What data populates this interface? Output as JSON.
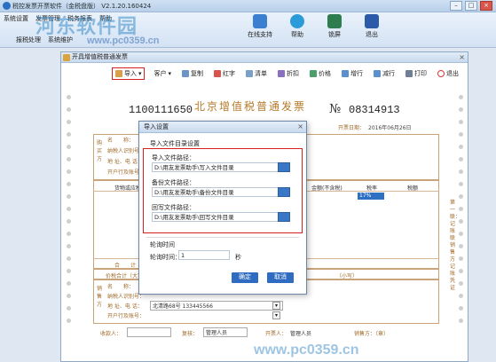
{
  "app": {
    "title": "税控发票开票软件（金税盘版） V2.1.20.160424",
    "menu_row1": [
      "系统设置",
      "发票管理",
      "税务报表",
      "帮助"
    ],
    "menu_row2": [
      "报税处理",
      "系统维护"
    ],
    "tools": [
      {
        "label": "在线支持",
        "icon": "support-icon",
        "color": "#3b7fd1"
      },
      {
        "label": "帮助",
        "icon": "help-icon",
        "color": "#2a9bd8"
      },
      {
        "label": "锁屏",
        "icon": "lock-icon",
        "color": "#2e7d4f"
      },
      {
        "label": "退出",
        "icon": "exit-icon",
        "color": "#2a5aa8"
      }
    ]
  },
  "watermark": {
    "line1": "河东软件园",
    "line2": "www.pc0359.cn",
    "bottom": "www.pc0359.cn"
  },
  "invoice_window": {
    "title": "开具增值税普通发票",
    "toolbar": [
      "导入",
      "客户",
      "复制",
      "红字",
      "清单",
      "折扣",
      "价格",
      "增行",
      "减行",
      "打印",
      "退出"
    ],
    "header": "北京增值税普通发票",
    "code": "1100111650",
    "no_symbol": "№",
    "number": "08314913",
    "issue_date_label": "开票日期：",
    "issue_date": "2016年06月26日",
    "buyer_side": "购买方",
    "buyer_fields": [
      "名　　称：",
      "纳税人识别号：",
      "地 址、电 话：",
      "开户行及账号："
    ],
    "table_headers": [
      "货物或应税劳务、服务名称",
      "金额(不含税)",
      "税率",
      "税额"
    ],
    "tax_rate": "17%",
    "total_label": "合　　计",
    "amount_words_label": "价税合计（大写）",
    "amount_small_label": "（小写）",
    "seller_side": "销售方",
    "seller_address": "北清路68号 13344556​6",
    "seller_fields": [
      "名　　称：",
      "纳税人识别号：",
      "地 址、电 话：",
      "开户行及账号："
    ],
    "right_vertical": "第一联：记账联 销售方记账凭证",
    "payee_label": "收款人：",
    "reviewer_label": "复核：",
    "reviewer": "管理人员",
    "drawer_label": "开票人：",
    "drawer": "管理人员",
    "seller_stamp_label": "销售方：（章）"
  },
  "dialog": {
    "title": "导入设置",
    "section": "导入文件目录设置",
    "import_label": "导入文件路径：",
    "import_path": "D:\\用友发票助手\\写入文件目录",
    "backup_label": "备份文件路径：",
    "backup_path": "D:\\用友发票助手\\备份文件目录",
    "writeback_label": "回写文件路径：",
    "writeback_path": "D:\\用友发票助手\\回写文件目录",
    "poll_section": "轮询时间",
    "poll_label": "轮询时间：",
    "poll_value": "1",
    "poll_unit": "秒",
    "ok": "确定",
    "cancel": "取消"
  }
}
